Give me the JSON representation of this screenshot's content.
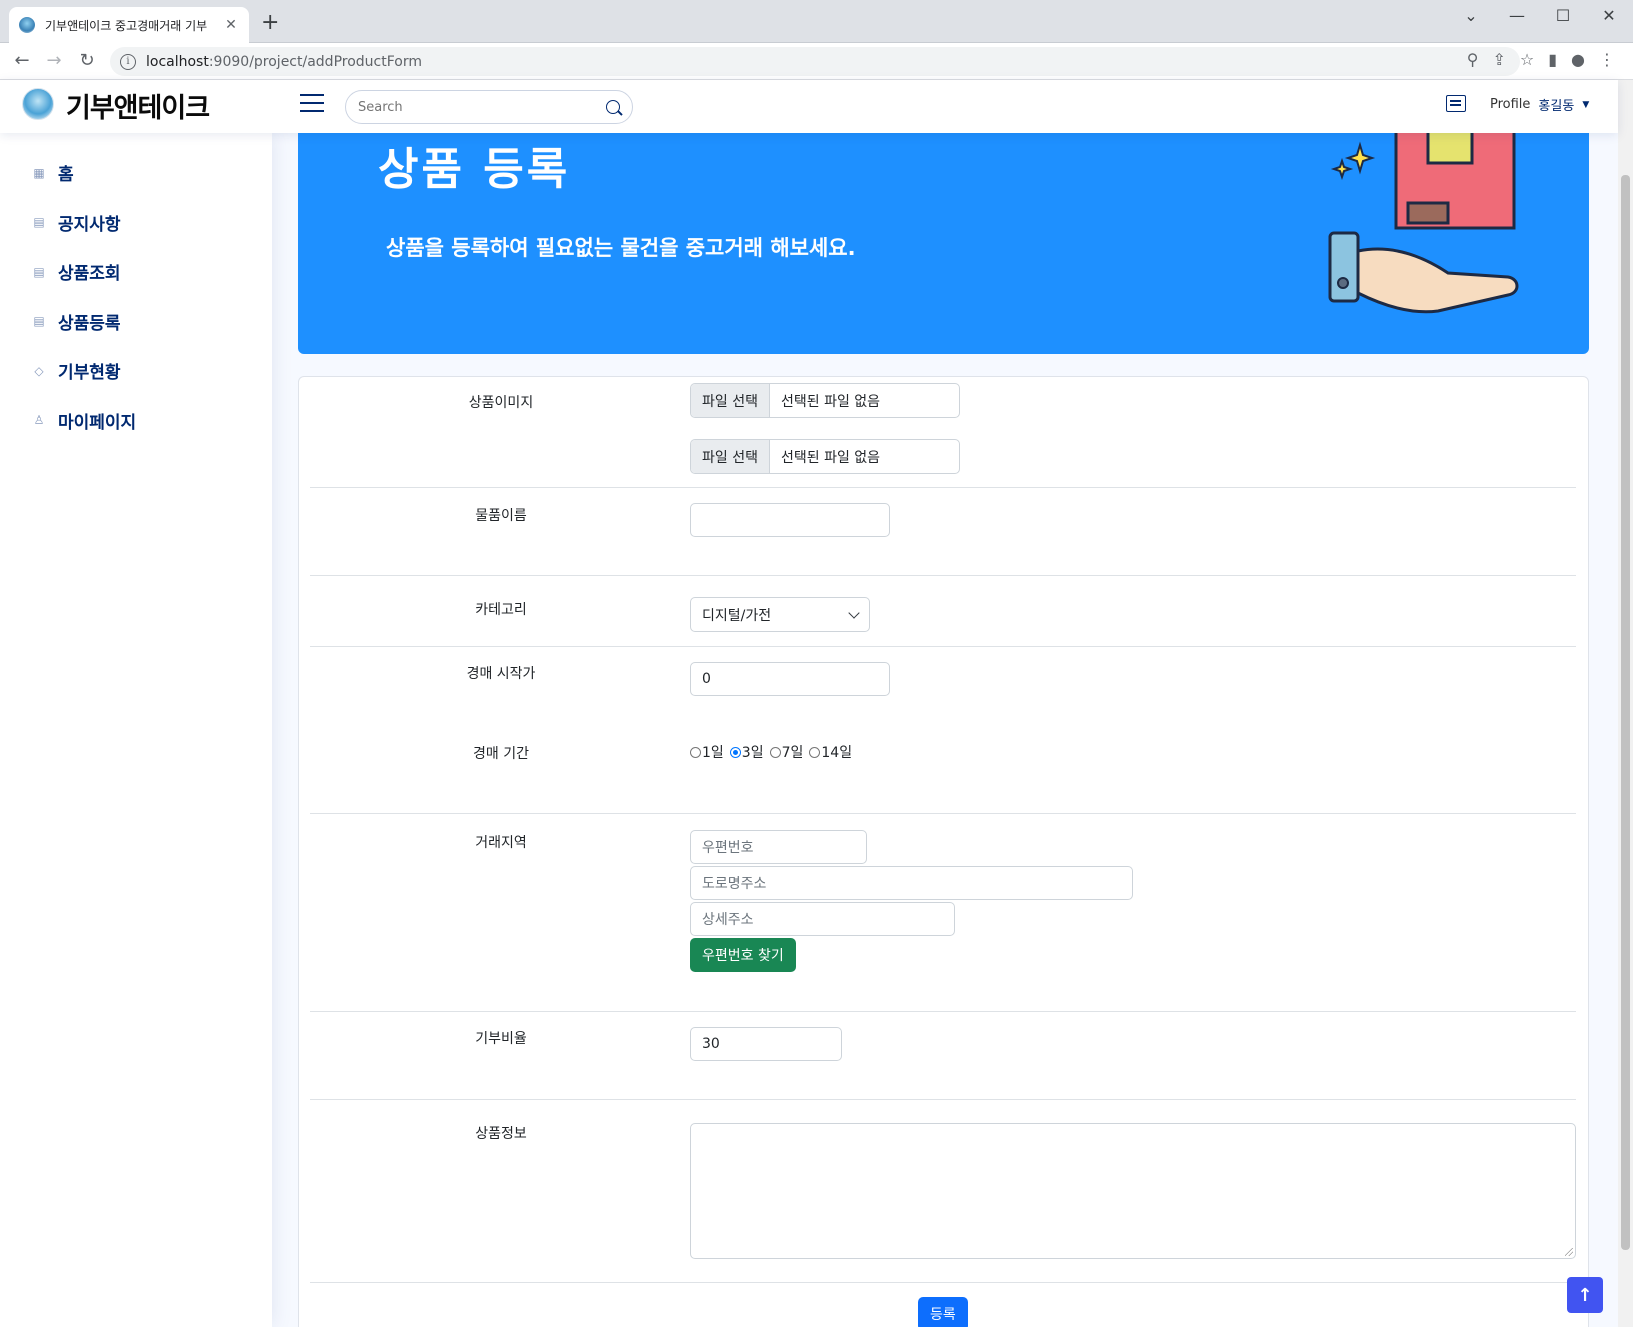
{
  "browser": {
    "tab_title": "기부앤테이크 중고경매거래 기부",
    "url_host": "localhost",
    "url_path": ":9090/project/addProductForm",
    "new_tab": "+",
    "min": "—",
    "max": "☐",
    "close": "✕",
    "tab_close": "✕",
    "chevron": "⌄"
  },
  "header": {
    "logo_text": "기부앤테이크",
    "search_placeholder": "Search",
    "profile_alt": "Profile",
    "user_name": "홍길동"
  },
  "sidebar": {
    "items": [
      {
        "label": "홈",
        "icon": "grid-icon"
      },
      {
        "label": "공지사항",
        "icon": "document-icon"
      },
      {
        "label": "상품조회",
        "icon": "list-icon"
      },
      {
        "label": "상품등록",
        "icon": "list-icon"
      },
      {
        "label": "기부현황",
        "icon": "gem-icon"
      },
      {
        "label": "마이페이지",
        "icon": "person-icon"
      }
    ]
  },
  "hero": {
    "title": "상품 등록",
    "subtitle": "상품을 등록하여 필요없는 물건을 중고거래 해보세요."
  },
  "form": {
    "image_label": "상품이미지",
    "file_button": "파일 선택",
    "file_none": "선택된 파일 없음",
    "name_label": "물품이름",
    "name_value": "",
    "category_label": "카테고리",
    "category_value": "디지털/가전",
    "start_price_label": "경매 시작가",
    "start_price_value": "0",
    "period_label": "경매 기간",
    "period_options": [
      "1일",
      "3일",
      "7일",
      "14일"
    ],
    "period_selected": "3일",
    "region_label": "거래지역",
    "zip_placeholder": "우편번호",
    "road_placeholder": "도로명주소",
    "detail_placeholder": "상세주소",
    "zip_button": "우편번호 찾기",
    "donation_label": "기부비율",
    "donation_value": "30",
    "info_label": "상품정보",
    "submit": "등록"
  },
  "colors": {
    "hero_bg": "#1e90ff",
    "nav_text": "#012970",
    "green_button": "#198754",
    "submit_button": "#0d6efd",
    "back_to_top": "#4154f1"
  }
}
